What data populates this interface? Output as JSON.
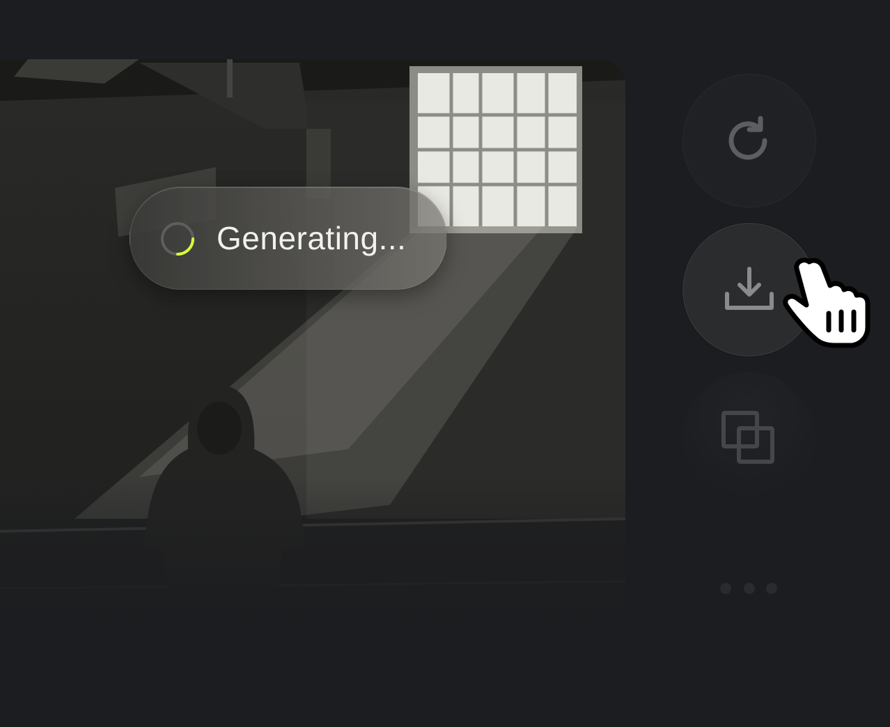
{
  "status": {
    "label": "Generating...",
    "progress": 0.25
  },
  "actions": [
    {
      "name": "regenerate",
      "icon": "refresh-icon"
    },
    {
      "name": "download",
      "icon": "download-icon",
      "state": "hover"
    },
    {
      "name": "duplicate",
      "icon": "copy-icon"
    },
    {
      "name": "more",
      "icon": "more-dots-icon"
    }
  ],
  "colors": {
    "background": "#1c1d20",
    "spinner_accent": "#d7ff3a",
    "icon": "#8a8b8d"
  }
}
